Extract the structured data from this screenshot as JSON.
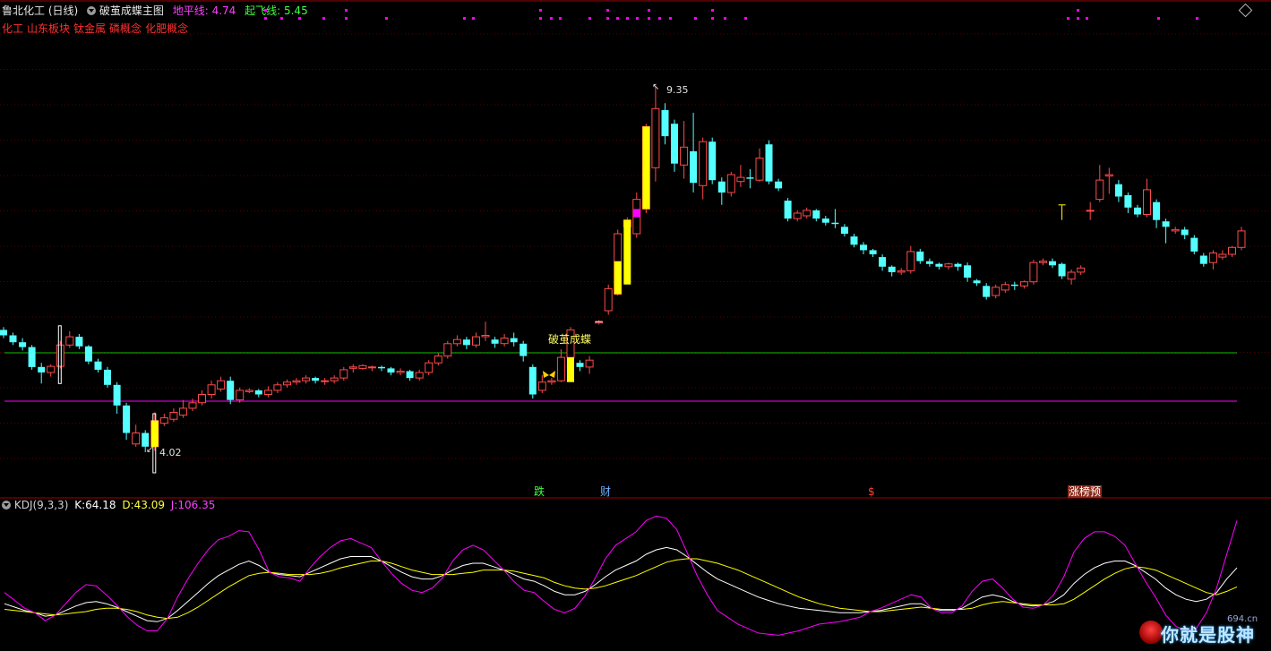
{
  "header": {
    "title": "鲁北化工 (日线)",
    "indicator_name": "破茧成蝶主图",
    "ground_line_label": "地平线:",
    "ground_line_value": "4.74",
    "takeoff_line_label": "起飞线:",
    "takeoff_line_value": "5.45"
  },
  "concept_tags": [
    "化工",
    "山东板块",
    "钛金属",
    "磷概念",
    "化肥概念"
  ],
  "sub_indicator": {
    "name": "KDJ(9,3,3)",
    "k_label": "K:",
    "k_value": "64.18",
    "d_label": "D:",
    "d_value": "43.09",
    "j_label": "J:",
    "j_value": "106.35"
  },
  "annotations": {
    "high_price": "9.35",
    "low_price": "4.02",
    "signal_text": "破茧成蝶"
  },
  "badges": {
    "drop": "跌",
    "finance": "财",
    "dollar": "$",
    "limit_up": "涨榜预"
  },
  "watermark": {
    "text": "你就是股神",
    "site": "694.cn"
  },
  "colors": {
    "up": "#ff4a4a",
    "down": "#54ffff",
    "signal": "#ffff00",
    "ground_line": "#00c000",
    "takeoff_line": "#ff00ff",
    "k_line": "#ffffff",
    "d_line": "#ffff00",
    "j_line": "#ff00ff",
    "dots": "#ff00ff"
  },
  "chart_data": [
    {
      "type": "candlestick",
      "title": "鲁北化工 (日线)",
      "price_range": [
        3.7,
        9.6
      ],
      "high_marker": 9.35,
      "low_marker": 4.02,
      "ground_line": 4.74,
      "takeoff_line": 5.45,
      "candles": [
        [
          5.8,
          5.72,
          5.84,
          5.68
        ],
        [
          5.72,
          5.62,
          5.76,
          5.58
        ],
        [
          5.62,
          5.55,
          5.68,
          5.5
        ],
        [
          5.55,
          5.26,
          5.58,
          5.22
        ],
        [
          5.26,
          5.18,
          5.32,
          5.02
        ],
        [
          5.18,
          5.27,
          5.3,
          5.12
        ],
        [
          5.27,
          5.58,
          5.64,
          5.24
        ],
        [
          5.58,
          5.7,
          5.78,
          5.54
        ],
        [
          5.7,
          5.56,
          5.74,
          5.52
        ],
        [
          5.56,
          5.34,
          5.58,
          5.3
        ],
        [
          5.34,
          5.22,
          5.38,
          5.18
        ],
        [
          5.22,
          5.0,
          5.26,
          4.96
        ],
        [
          5.0,
          4.7,
          5.04,
          4.58
        ],
        [
          4.7,
          4.3,
          4.74,
          4.2
        ],
        [
          4.14,
          4.3,
          4.42,
          4.1
        ],
        [
          4.3,
          4.1,
          4.34,
          4.02
        ],
        [
          4.1,
          4.48,
          4.6,
          4.04
        ],
        [
          4.44,
          4.52,
          4.58,
          4.4
        ],
        [
          4.5,
          4.6,
          4.66,
          4.46
        ],
        [
          4.56,
          4.66,
          4.78,
          4.52
        ],
        [
          4.66,
          4.74,
          4.8,
          4.62
        ],
        [
          4.74,
          4.86,
          4.92,
          4.7
        ],
        [
          4.86,
          5.0,
          5.06,
          4.8
        ],
        [
          4.94,
          5.06,
          5.12,
          4.9
        ],
        [
          5.06,
          4.78,
          5.12,
          4.72
        ],
        [
          4.78,
          4.92,
          4.96,
          4.74
        ],
        [
          4.9,
          4.92,
          4.95,
          4.88
        ],
        [
          4.92,
          4.86,
          4.94,
          4.82
        ],
        [
          4.86,
          4.92,
          4.98,
          4.82
        ],
        [
          4.92,
          5.0,
          5.04,
          4.88
        ],
        [
          5.0,
          5.04,
          5.08,
          4.96
        ],
        [
          5.04,
          5.06,
          5.1,
          5.0
        ],
        [
          5.06,
          5.1,
          5.14,
          5.02
        ],
        [
          5.1,
          5.06,
          5.12,
          5.02
        ],
        [
          5.06,
          5.06,
          5.1,
          5.0
        ],
        [
          5.06,
          5.1,
          5.14,
          5.02
        ],
        [
          5.1,
          5.22,
          5.26,
          5.06
        ],
        [
          5.24,
          5.26,
          5.3,
          5.18
        ],
        [
          5.24,
          5.28,
          5.3,
          5.22
        ],
        [
          5.26,
          5.26,
          5.28,
          5.2
        ],
        [
          5.26,
          5.24,
          5.28,
          5.2
        ],
        [
          5.24,
          5.18,
          5.26,
          5.14
        ],
        [
          5.18,
          5.2,
          5.24,
          5.14
        ],
        [
          5.2,
          5.1,
          5.22,
          5.06
        ],
        [
          5.1,
          5.18,
          5.22,
          5.06
        ],
        [
          5.18,
          5.32,
          5.36,
          5.14
        ],
        [
          5.32,
          5.42,
          5.46,
          5.28
        ],
        [
          5.42,
          5.6,
          5.64,
          5.38
        ],
        [
          5.6,
          5.66,
          5.72,
          5.56
        ],
        [
          5.66,
          5.58,
          5.7,
          5.52
        ],
        [
          5.58,
          5.7,
          5.76,
          5.54
        ],
        [
          5.7,
          5.72,
          5.92,
          5.64
        ],
        [
          5.66,
          5.6,
          5.7,
          5.54
        ],
        [
          5.6,
          5.68,
          5.74,
          5.56
        ],
        [
          5.68,
          5.62,
          5.76,
          5.56
        ],
        [
          5.6,
          5.42,
          5.64,
          5.34
        ],
        [
          5.26,
          4.86,
          5.3,
          4.8
        ],
        [
          4.92,
          5.04,
          5.14,
          4.88
        ],
        [
          5.04,
          5.06,
          5.1,
          5.0
        ],
        [
          5.06,
          5.4,
          5.52,
          5.04
        ],
        [
          5.4,
          5.8,
          5.84,
          5.4
        ],
        [
          5.32,
          5.26,
          5.36,
          5.2
        ],
        [
          5.26,
          5.36,
          5.42,
          5.16
        ],
        [
          5.9,
          5.92,
          5.94,
          5.88
        ],
        [
          6.08,
          6.4,
          6.46,
          6.02
        ],
        [
          6.32,
          7.2,
          7.26,
          6.3
        ],
        [
          7.3,
          7.4,
          7.44,
          7.1
        ],
        [
          7.2,
          7.7,
          7.8,
          7.14
        ],
        [
          7.56,
          8.76,
          8.8,
          7.5
        ],
        [
          8.16,
          9.02,
          9.35,
          7.96
        ],
        [
          9.0,
          8.62,
          9.1,
          8.5
        ],
        [
          8.8,
          8.22,
          8.86,
          8.1
        ],
        [
          8.2,
          8.46,
          8.84,
          8.0
        ],
        [
          8.4,
          7.94,
          8.96,
          7.8
        ],
        [
          7.9,
          8.54,
          8.6,
          7.7
        ],
        [
          8.54,
          7.98,
          8.6,
          7.92
        ],
        [
          7.96,
          7.8,
          8.02,
          7.62
        ],
        [
          7.8,
          8.06,
          8.1,
          7.74
        ],
        [
          7.96,
          8.02,
          8.2,
          7.88
        ],
        [
          8.02,
          8.0,
          8.14,
          7.86
        ],
        [
          7.98,
          8.3,
          8.44,
          7.96
        ],
        [
          8.5,
          7.96,
          8.56,
          7.92
        ],
        [
          7.96,
          7.86,
          8.0,
          7.82
        ],
        [
          7.68,
          7.42,
          7.72,
          7.38
        ],
        [
          7.42,
          7.5,
          7.54,
          7.38
        ],
        [
          7.46,
          7.54,
          7.58,
          7.42
        ],
        [
          7.54,
          7.42,
          7.56,
          7.38
        ],
        [
          7.42,
          7.36,
          7.46,
          7.32
        ],
        [
          7.36,
          7.34,
          7.56,
          7.28
        ],
        [
          7.3,
          7.2,
          7.34,
          7.16
        ],
        [
          7.16,
          7.04,
          7.2,
          7.0
        ],
        [
          7.04,
          6.96,
          7.08,
          6.9
        ],
        [
          6.96,
          6.9,
          6.98,
          6.86
        ],
        [
          6.86,
          6.72,
          6.9,
          6.66
        ],
        [
          6.72,
          6.64,
          6.74,
          6.58
        ],
        [
          6.64,
          6.66,
          6.7,
          6.6
        ],
        [
          6.66,
          6.94,
          7.02,
          6.62
        ],
        [
          6.94,
          6.8,
          6.98,
          6.76
        ],
        [
          6.8,
          6.76,
          6.84,
          6.72
        ],
        [
          6.76,
          6.72,
          6.78,
          6.68
        ],
        [
          6.72,
          6.76,
          6.78,
          6.68
        ],
        [
          6.76,
          6.72,
          6.78,
          6.66
        ],
        [
          6.74,
          6.56,
          6.78,
          6.5
        ],
        [
          6.52,
          6.48,
          6.54,
          6.44
        ],
        [
          6.44,
          6.28,
          6.48,
          6.24
        ],
        [
          6.3,
          6.42,
          6.46,
          6.26
        ],
        [
          6.38,
          6.46,
          6.5,
          6.34
        ],
        [
          6.46,
          6.44,
          6.5,
          6.38
        ],
        [
          6.44,
          6.5,
          6.52,
          6.4
        ],
        [
          6.5,
          6.78,
          6.82,
          6.46
        ],
        [
          6.78,
          6.8,
          6.84,
          6.74
        ],
        [
          6.8,
          6.74,
          6.84,
          6.7
        ],
        [
          6.76,
          6.58,
          6.78,
          6.54
        ],
        [
          6.54,
          6.64,
          6.68,
          6.46
        ],
        [
          6.64,
          6.7,
          6.74,
          6.6
        ],
        [
          7.54,
          7.54,
          7.66,
          7.4
        ],
        [
          7.7,
          7.98,
          8.2,
          7.66
        ],
        [
          8.04,
          8.06,
          8.16,
          7.78
        ],
        [
          7.92,
          7.74,
          7.98,
          7.66
        ],
        [
          7.76,
          7.58,
          7.8,
          7.5
        ],
        [
          7.58,
          7.48,
          7.62,
          7.44
        ],
        [
          7.48,
          7.84,
          8.0,
          7.44
        ],
        [
          7.66,
          7.4,
          7.7,
          7.28
        ],
        [
          7.38,
          7.3,
          7.42,
          7.06
        ],
        [
          7.24,
          7.26,
          7.3,
          7.2
        ],
        [
          7.26,
          7.18,
          7.3,
          7.12
        ],
        [
          7.14,
          6.94,
          7.18,
          6.9
        ],
        [
          6.88,
          6.76,
          6.92,
          6.72
        ],
        [
          6.78,
          6.92,
          6.96,
          6.68
        ],
        [
          6.86,
          6.9,
          6.96,
          6.82
        ],
        [
          6.9,
          7.0,
          7.02,
          6.86
        ],
        [
          7.0,
          7.24,
          7.3,
          6.96
        ]
      ]
    },
    {
      "type": "line",
      "title": "KDJ(9,3,3)",
      "ylim": [
        -10,
        115
      ],
      "series": [
        {
          "name": "K",
          "values": [
            32,
            29,
            26,
            24,
            21,
            22,
            26,
            30,
            33,
            34,
            32,
            29,
            25,
            21,
            17,
            16,
            19,
            26,
            34,
            42,
            50,
            57,
            62,
            67,
            70,
            66,
            60,
            58,
            57,
            56,
            60,
            64,
            68,
            72,
            74,
            74,
            74,
            70,
            65,
            60,
            56,
            54,
            54,
            57,
            62,
            66,
            68,
            68,
            65,
            62,
            58,
            54,
            52,
            48,
            43,
            40,
            40,
            43,
            49,
            56,
            62,
            66,
            70,
            76,
            80,
            82,
            80,
            74,
            67,
            60,
            54,
            50,
            46,
            42,
            38,
            35,
            32,
            30,
            28,
            27,
            26,
            25,
            24,
            24,
            24,
            25,
            26,
            28,
            30,
            32,
            32,
            28,
            26,
            26,
            28,
            33,
            38,
            40,
            38,
            34,
            31,
            30,
            31,
            34,
            40,
            50,
            58,
            64,
            68,
            70,
            70,
            66,
            60,
            54,
            46,
            40,
            36,
            34,
            36,
            42,
            54,
            64
          ]
        },
        {
          "name": "D",
          "values": [
            27,
            26,
            25,
            24,
            23,
            22,
            23,
            24,
            25,
            27,
            28,
            28,
            27,
            25,
            22,
            20,
            19,
            20,
            24,
            29,
            35,
            41,
            47,
            52,
            57,
            59,
            60,
            59,
            58,
            58,
            58,
            59,
            61,
            64,
            66,
            68,
            70,
            70,
            68,
            65,
            62,
            60,
            58,
            58,
            58,
            59,
            60,
            62,
            62,
            62,
            61,
            59,
            57,
            55,
            51,
            48,
            46,
            45,
            46,
            48,
            51,
            54,
            57,
            61,
            65,
            69,
            71,
            72,
            72,
            70,
            68,
            65,
            62,
            58,
            54,
            50,
            46,
            42,
            38,
            35,
            32,
            30,
            28,
            27,
            26,
            25,
            25,
            26,
            27,
            28,
            29,
            28,
            27,
            27,
            27,
            28,
            31,
            33,
            34,
            33,
            32,
            31,
            31,
            31,
            32,
            36,
            42,
            48,
            54,
            59,
            63,
            65,
            64,
            62,
            58,
            54,
            50,
            46,
            42,
            40,
            43,
            47
          ]
        },
        {
          "name": "J",
          "values": [
            42,
            35,
            28,
            24,
            17,
            22,
            32,
            42,
            49,
            48,
            40,
            31,
            21,
            13,
            8,
            8,
            19,
            38,
            54,
            68,
            80,
            89,
            92,
            97,
            96,
            80,
            60,
            56,
            55,
            52,
            64,
            74,
            82,
            88,
            90,
            86,
            82,
            70,
            59,
            50,
            44,
            42,
            46,
            55,
            70,
            80,
            84,
            80,
            71,
            62,
            52,
            44,
            42,
            34,
            27,
            24,
            28,
            39,
            55,
            72,
            84,
            90,
            96,
            106,
            110,
            108,
            98,
            78,
            57,
            40,
            26,
            20,
            14,
            10,
            6,
            5,
            4,
            6,
            8,
            11,
            14,
            15,
            16,
            18,
            20,
            25,
            28,
            32,
            36,
            40,
            38,
            28,
            24,
            24,
            30,
            43,
            52,
            54,
            46,
            36,
            29,
            28,
            31,
            40,
            56,
            78,
            90,
            96,
            96,
            92,
            84,
            68,
            52,
            38,
            22,
            12,
            8,
            10,
            24,
            46,
            76,
            106
          ]
        }
      ]
    }
  ]
}
